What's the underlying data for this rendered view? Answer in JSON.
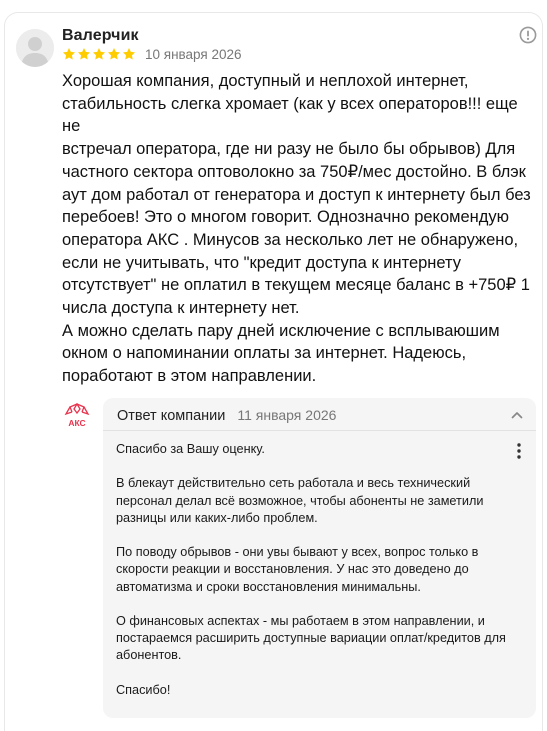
{
  "review": {
    "author": "Валерчик",
    "rating": 5,
    "rating_max": 5,
    "star_color": "#ffcc00",
    "date": "10 января 2026",
    "text": "Хорошая компания, доступный и неплохой интернет,\nстабильность слегка хромает (как у всех операторов!!! еще не\nвстречал оператора, где ни разу не было бы обрывов) Для\nчастного сектора оптоволокно за 750₽/мес достойно. В блэк\nаут дом работал от генератора и доступ к интернету был без\nперебоев! Это о многом говорит. Однозначно рекомендую\nоператора АКС . Минусов за несколько лет не обнаружено,\nесли не учитывать, что \"кредит доступа к интернету\nотсутствует\" не оплатил в текущем месяце баланс в +750₽ 1\nчисла доступа к интернету нет.\nА можно сделать пару дней исключение с всплываюшим\nокном о напоминании оплаты за интернет. Надеюсь,\nпоработают в этом направлении."
  },
  "reply": {
    "logo_text": "АКС",
    "logo_color": "#e8344e",
    "title": "Ответ компании",
    "date": "11 января 2026",
    "paragraphs": [
      "Спасибо за Вашу оценку.",
      "В блекаут действительно сеть работала и весь технический персонал делал всё возможное, чтобы абоненты не заметили разницы или каких-либо проблем.",
      "По поводу обрывов - они увы бывают у всех, вопрос только в скорости реакции и восстановления. У нас это доведено до автоматизма и сроки восстановления минимальны.",
      "О финансовых аспектах - мы работаем в этом направлении, и постараемся расширить доступные вариации оплат/кредитов для абонентов.",
      "Спасибо!"
    ]
  }
}
